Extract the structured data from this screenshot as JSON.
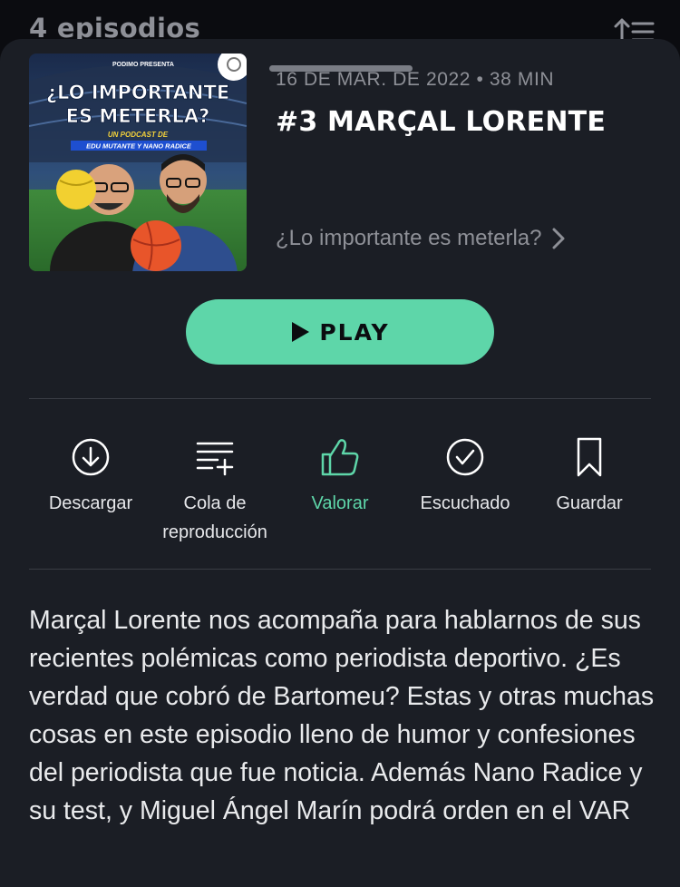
{
  "background_header": {
    "title": "4 episodios",
    "sort_icon": "sort-icon"
  },
  "episode": {
    "meta": "16 DE MAR. DE 2022 • 38 MIN",
    "title": "#3 MARÇAL LORENTE",
    "podcast_link": "¿Lo importante es meterla?",
    "cover": {
      "presenter": "PODIMO PRESENTA",
      "line1": "¿LO IMPORTANTE",
      "line2": "ES METERLA?",
      "subtitle1": "UN PODCAST DE",
      "subtitle2": "EDU MUTANTE Y NANO RADICE"
    }
  },
  "play_button": {
    "label": "PLAY",
    "icon": "play-icon"
  },
  "actions": [
    {
      "label": "Descargar",
      "icon": "download-icon",
      "active": false
    },
    {
      "label": "Cola de reproducción",
      "icon": "queue-add-icon",
      "active": false
    },
    {
      "label": "Valorar",
      "icon": "thumbs-up-icon",
      "active": true
    },
    {
      "label": "Escuchado",
      "icon": "check-circle-icon",
      "active": false
    },
    {
      "label": "Guardar",
      "icon": "bookmark-icon",
      "active": false
    }
  ],
  "description": "Marçal Lorente nos acompaña para hablarnos de sus recientes polémicas como periodista deportivo. ¿Es verdad que cobró de Bartomeu? Estas y otras muchas cosas en este episodio lleno de humor y confesiones del periodista que fue noticia. Además Nano Radice y su test, y Miguel Ángel Marín podrá orden en el VAR",
  "colors": {
    "accent": "#5ed6a9",
    "sheet": "#1b1e25",
    "background": "#0b0c10",
    "muted_text": "#8e9097"
  }
}
